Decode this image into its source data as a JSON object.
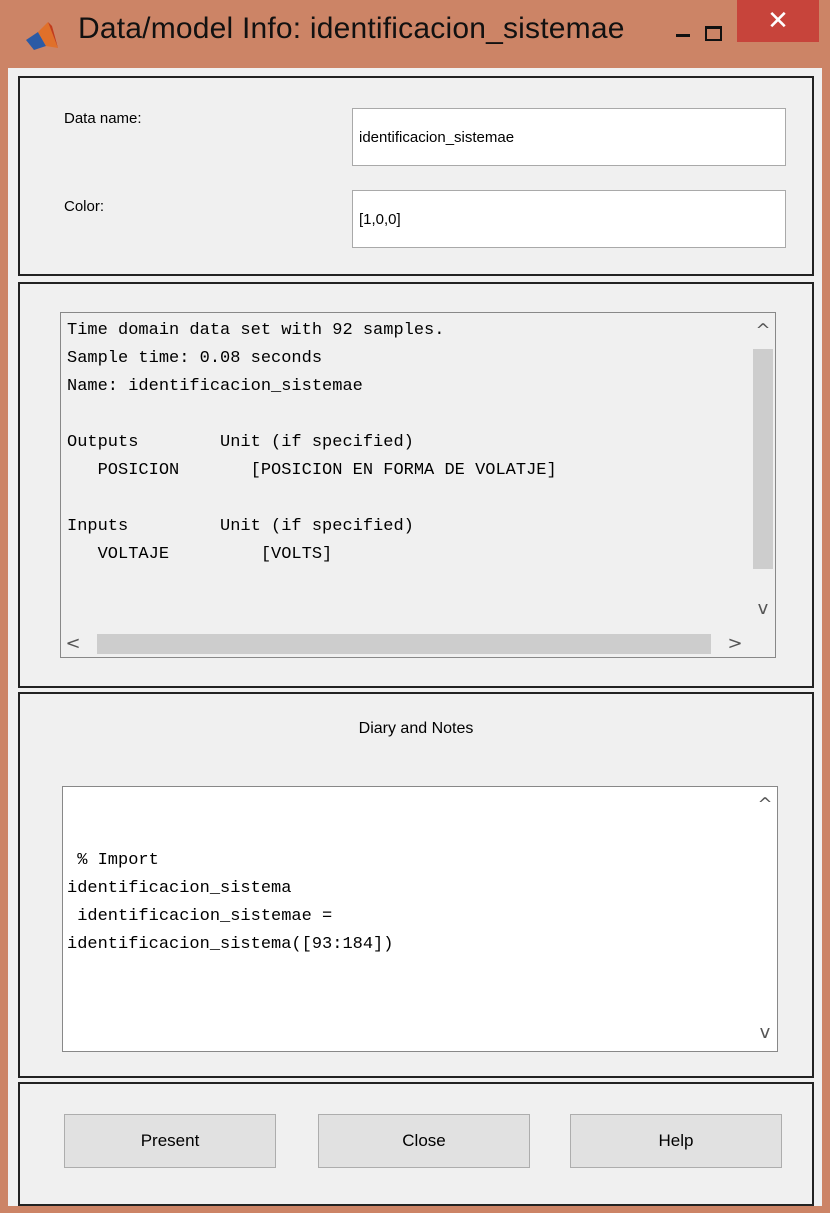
{
  "window": {
    "title": "Data/model Info: identificacion_sistemae",
    "icon": "matlab-icon",
    "controls": {
      "minimize": "–",
      "maximize": "□",
      "close": "✕"
    }
  },
  "fields": {
    "name_label": "Data name:",
    "name_value": "identificacion_sistemae",
    "color_label": "Color:",
    "color_value": "[1,0,0]"
  },
  "info": {
    "lines": [
      "Time domain data set with 92 samples.",
      "Sample time: 0.08 seconds",
      "Name: identificacion_sistemae",
      "",
      "Outputs        Unit (if specified)",
      "   POSICION       [POSICION EN FORMA DE VOLATJE]",
      "",
      "Inputs         Unit (if specified)",
      "   VOLTAJE         [VOLTS]"
    ]
  },
  "diary": {
    "label": "Diary and Notes",
    "lines": [
      "",
      "",
      " % Import",
      "identificacion_sistema",
      " identificacion_sistemae =",
      "identificacion_sistema([93:184])"
    ]
  },
  "buttons": {
    "present": "Present",
    "close": "Close",
    "help": "Help"
  },
  "scroll_glyphs": {
    "up": "^",
    "down": "v",
    "left": "<",
    "right": ">"
  }
}
